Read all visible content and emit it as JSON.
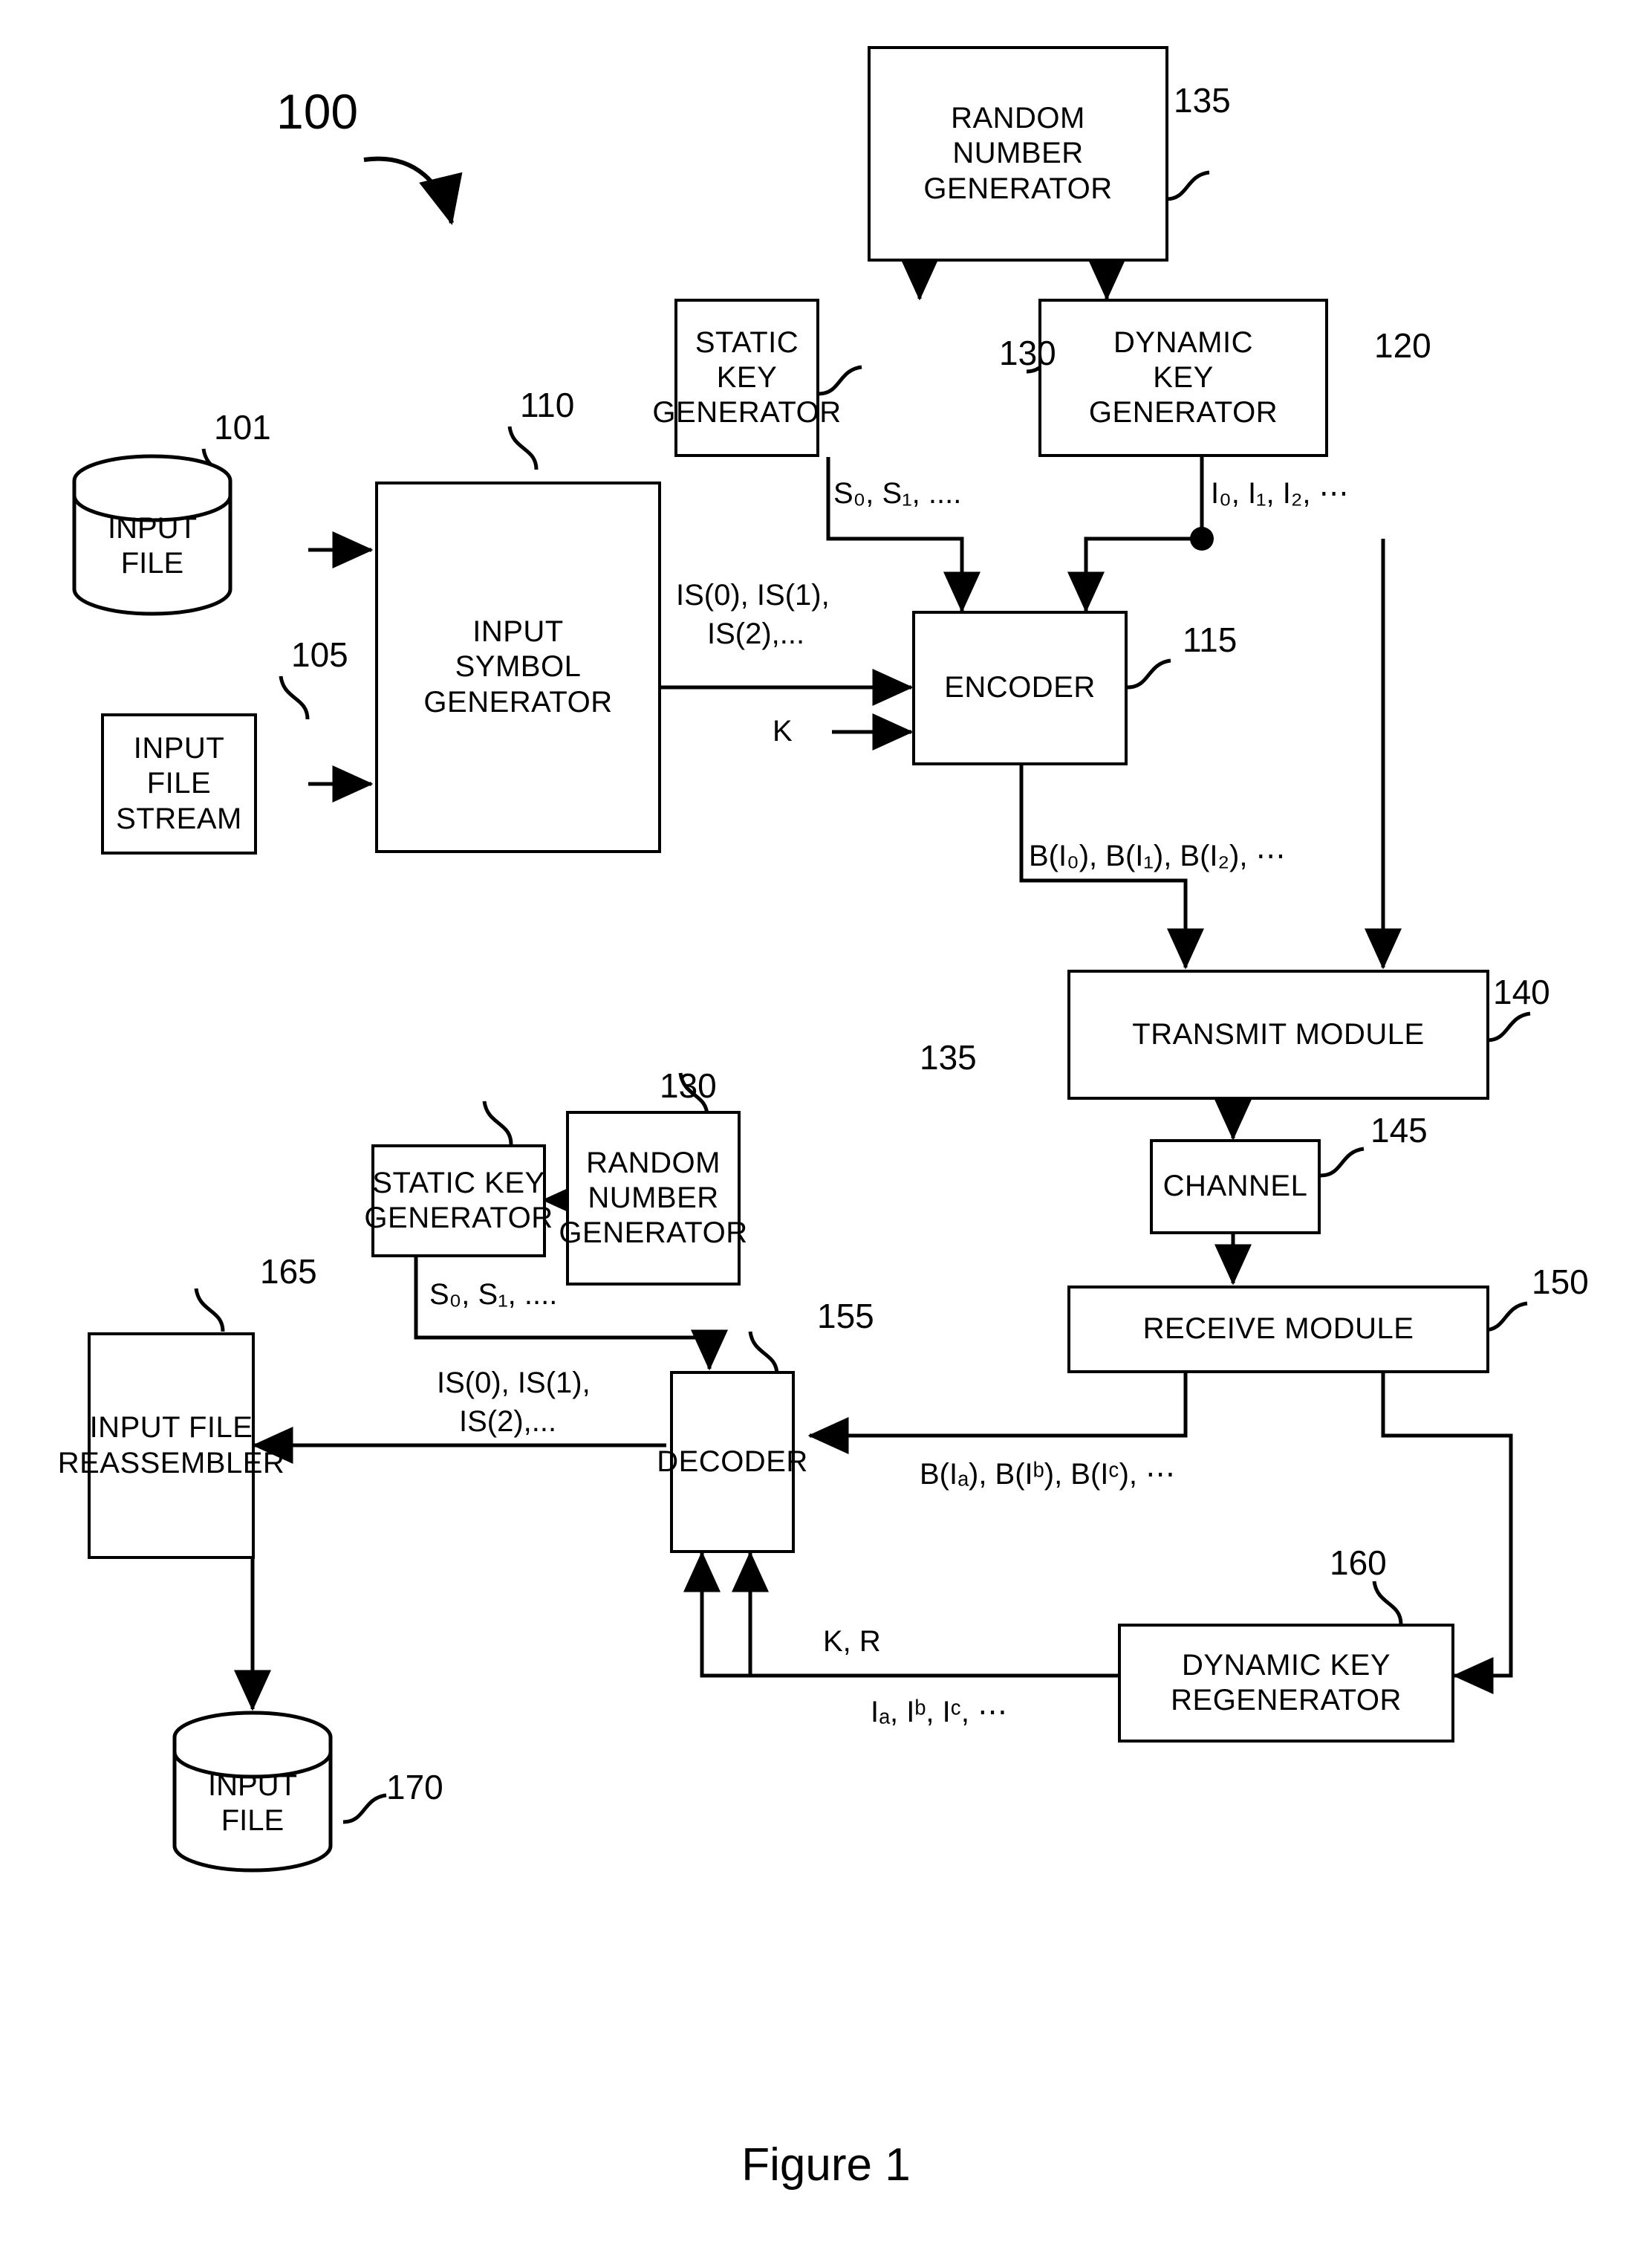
{
  "figure": {
    "caption": "Figure 1",
    "system_ref": "100"
  },
  "nodes": [
    {
      "id": "input_file_src",
      "label": "INPUT\nFILE",
      "ref": "101",
      "shape": "cylinder"
    },
    {
      "id": "input_file_stream",
      "label": "INPUT\nFILE\nSTREAM",
      "ref": "105",
      "shape": "box"
    },
    {
      "id": "input_symbol_gen",
      "label": "INPUT\nSYMBOL\nGENERATOR",
      "ref": "110",
      "shape": "box"
    },
    {
      "id": "encoder",
      "label": "ENCODER",
      "ref": "115",
      "shape": "box"
    },
    {
      "id": "dynamic_key_gen",
      "label": "DYNAMIC\nKEY\nGENERATOR",
      "ref": "120",
      "shape": "box"
    },
    {
      "id": "static_key_gen_tx",
      "label": "STATIC\nKEY\nGENERATOR",
      "ref": "130",
      "shape": "box"
    },
    {
      "id": "rng_tx",
      "label": "RANDOM\nNUMBER\nGENERATOR",
      "ref": "135",
      "shape": "box"
    },
    {
      "id": "transmit_module",
      "label": "TRANSMIT MODULE",
      "ref": "140",
      "shape": "box"
    },
    {
      "id": "channel",
      "label": "CHANNEL",
      "ref": "145",
      "shape": "box"
    },
    {
      "id": "receive_module",
      "label": "RECEIVE MODULE",
      "ref": "150",
      "shape": "box"
    },
    {
      "id": "static_key_gen_rx",
      "label": "STATIC KEY\nGENERATOR",
      "ref": "130",
      "shape": "box"
    },
    {
      "id": "rng_rx",
      "label": "RANDOM\nNUMBER\nGENERATOR",
      "ref": "135",
      "shape": "box"
    },
    {
      "id": "decoder",
      "label": "DECODER",
      "ref": "155",
      "shape": "box"
    },
    {
      "id": "dyn_key_regen",
      "label": "DYNAMIC KEY\nREGENERATOR",
      "ref": "160",
      "shape": "box"
    },
    {
      "id": "reassembler",
      "label": "INPUT FILE\nREASSEMBLER",
      "ref": "165",
      "shape": "box"
    },
    {
      "id": "input_file_out",
      "label": "INPUT\nFILE",
      "ref": "170",
      "shape": "cylinder"
    }
  ],
  "edge_labels": {
    "static_keys_tx": "S₀, S₁, ....",
    "dynamic_keys_tx": "I₀, I₁, I₂, ⋯",
    "input_symbols_tx_l1": "IS(0), IS(1),",
    "input_symbols_tx_l2": "IS(2),...",
    "key_k": "K",
    "output_symbols_tx": "B(I₀), B(I₁), B(I₂), ⋯",
    "static_keys_rx": "S₀, S₁, ....",
    "input_symbols_rx_l1": "IS(0), IS(1),",
    "input_symbols_rx_l2": "IS(2),...",
    "output_symbols_rx": "B(Iₐ), B(Iᵇ), B(Iᶜ), ⋯",
    "key_k_r": "K, R",
    "dynamic_keys_rx": "Iₐ, Iᵇ, Iᶜ, ⋯"
  },
  "colors": {
    "stroke": "#000000",
    "background": "#ffffff"
  }
}
